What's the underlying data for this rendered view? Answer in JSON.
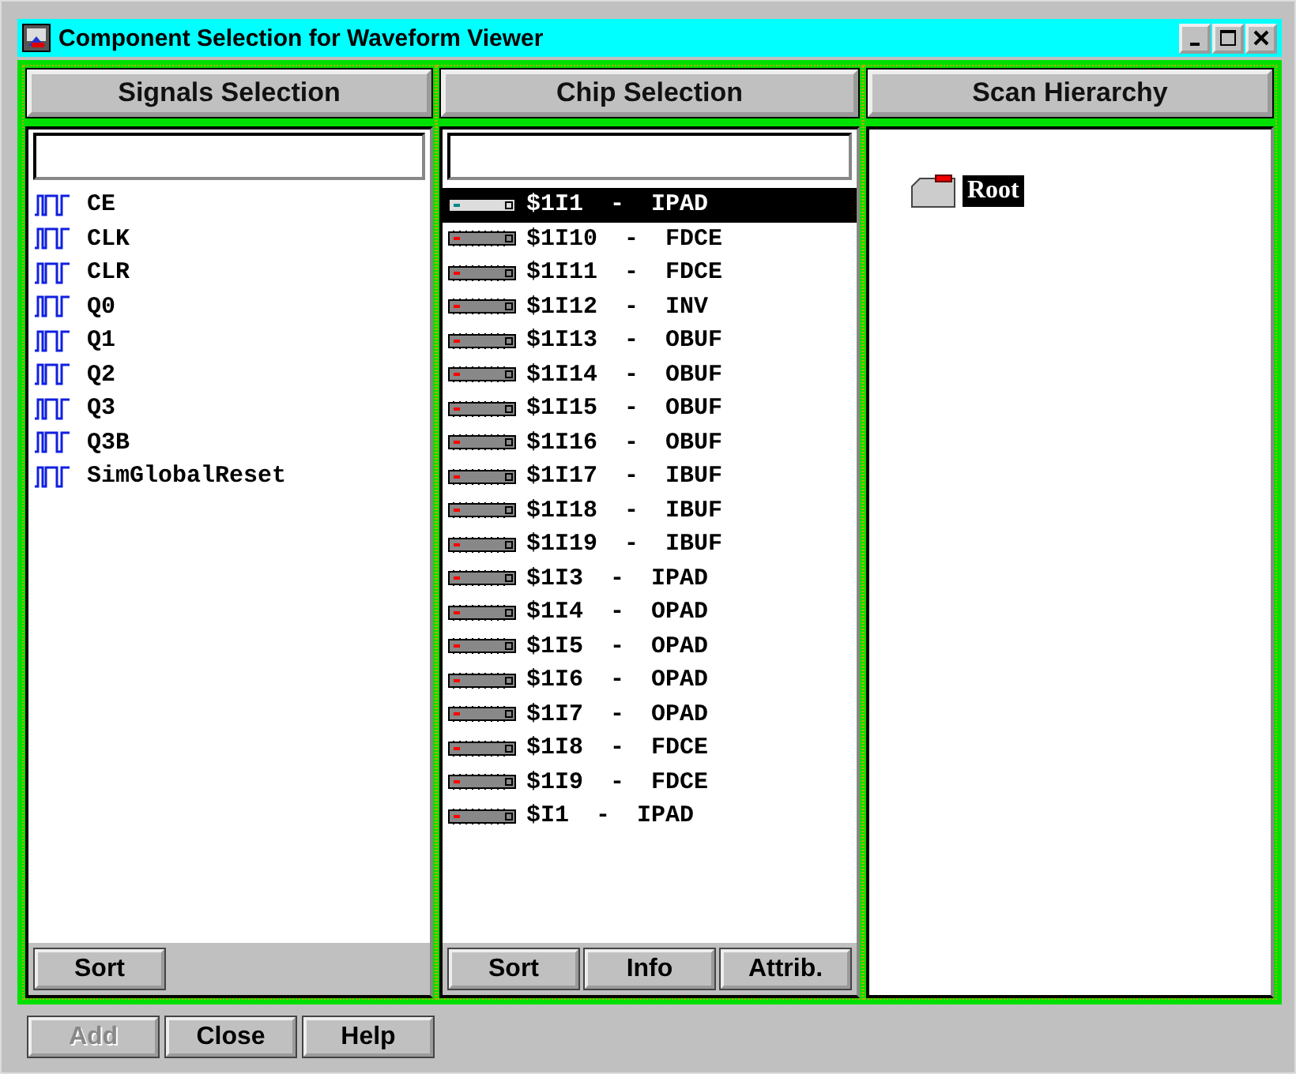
{
  "window": {
    "title": "Component Selection for Waveform Viewer"
  },
  "signals_panel": {
    "header": "Signals Selection",
    "items": [
      {
        "label": "CE",
        "selected": false
      },
      {
        "label": "CLK",
        "selected": false
      },
      {
        "label": "CLR",
        "selected": false
      },
      {
        "label": "Q0",
        "selected": false
      },
      {
        "label": "Q1",
        "selected": false
      },
      {
        "label": "Q2",
        "selected": false
      },
      {
        "label": "Q3",
        "selected": false
      },
      {
        "label": "Q3B",
        "selected": false
      },
      {
        "label": "SimGlobalReset",
        "selected": false
      }
    ],
    "buttons": [
      {
        "label": "Sort",
        "disabled": false
      }
    ]
  },
  "chip_panel": {
    "header": "Chip Selection",
    "items": [
      {
        "label": "$1I1 - IPAD",
        "selected": true
      },
      {
        "label": "$1I10 - FDCE",
        "selected": false
      },
      {
        "label": "$1I11 - FDCE",
        "selected": false
      },
      {
        "label": "$1I12 - INV",
        "selected": false
      },
      {
        "label": "$1I13 - OBUF",
        "selected": false
      },
      {
        "label": "$1I14 - OBUF",
        "selected": false
      },
      {
        "label": "$1I15 - OBUF",
        "selected": false
      },
      {
        "label": "$1I16 - OBUF",
        "selected": false
      },
      {
        "label": "$1I17 - IBUF",
        "selected": false
      },
      {
        "label": "$1I18 - IBUF",
        "selected": false
      },
      {
        "label": "$1I19 - IBUF",
        "selected": false
      },
      {
        "label": "$1I3 - IPAD",
        "selected": false
      },
      {
        "label": "$1I4 - OPAD",
        "selected": false
      },
      {
        "label": "$1I5 - OPAD",
        "selected": false
      },
      {
        "label": "$1I6 - OPAD",
        "selected": false
      },
      {
        "label": "$1I7 - OPAD",
        "selected": false
      },
      {
        "label": "$1I8 - FDCE",
        "selected": false
      },
      {
        "label": "$1I9 - FDCE",
        "selected": false
      },
      {
        "label": "$I1 - IPAD",
        "selected": false
      }
    ],
    "buttons": [
      {
        "label": "Sort",
        "disabled": false
      },
      {
        "label": "Info",
        "disabled": false
      },
      {
        "label": "Attrib.",
        "disabled": false
      }
    ]
  },
  "hierarchy_panel": {
    "header": "Scan Hierarchy",
    "tree": [
      {
        "label": "Root",
        "selected": true
      }
    ]
  },
  "buttons": [
    {
      "label": "Add",
      "disabled": true
    },
    {
      "label": "Close",
      "disabled": false
    },
    {
      "label": "Help",
      "disabled": false
    }
  ]
}
